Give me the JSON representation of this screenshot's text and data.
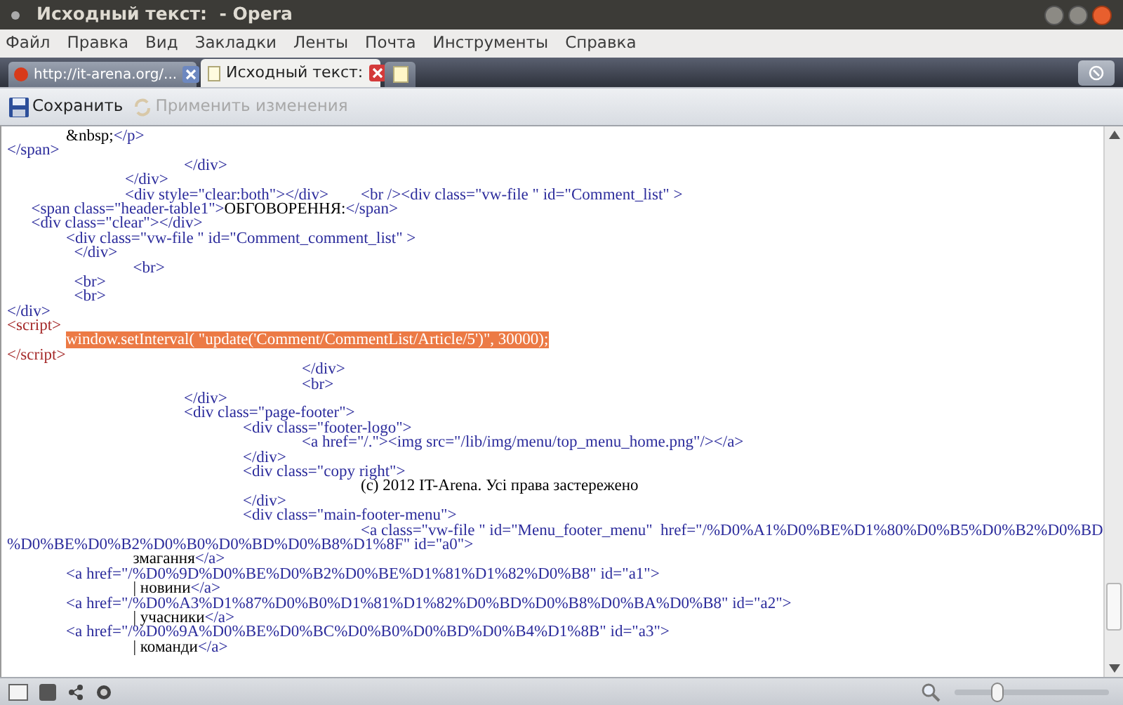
{
  "window": {
    "title": "Исходный текст:  - Opera"
  },
  "menu": [
    {
      "label": "Файл"
    },
    {
      "label": "Правка"
    },
    {
      "label": "Вид"
    },
    {
      "label": "Закладки"
    },
    {
      "label": "Ленты"
    },
    {
      "label": "Почта"
    },
    {
      "label": "Инструменты"
    },
    {
      "label": "Справка"
    }
  ],
  "tabs": [
    {
      "title": "http://it-arena.org/...",
      "selected": false
    },
    {
      "title": "Исходный текст:",
      "selected": true
    }
  ],
  "toolbar": [
    {
      "label": "Сохранить",
      "disabled": false
    },
    {
      "label": "Применить изменения",
      "disabled": true
    }
  ],
  "source_lines": [
    {
      "parts": [
        {
          "kind": "text",
          "text": "\t&nbsp;"
        },
        {
          "kind": "tag",
          "text": "</p>"
        }
      ]
    },
    {
      "parts": [
        {
          "kind": "tag",
          "text": "</span>"
        }
      ]
    },
    {
      "parts": [
        {
          "kind": "tag",
          "text": "\t\t\t</div>"
        }
      ]
    },
    {
      "parts": [
        {
          "kind": "tag",
          "text": "\t\t</div>"
        }
      ]
    },
    {
      "parts": [
        {
          "kind": "tag",
          "text": "\t\t<div style=\"clear:both\"></div>        <br /><div class=\"vw-file \" id=\"Comment_list\" >"
        }
      ]
    },
    {
      "parts": [
        {
          "kind": "tag",
          "text": "      <span class=\"header-table1\">"
        },
        {
          "kind": "text",
          "text": "ОБГОВОРЕННЯ:"
        },
        {
          "kind": "tag",
          "text": "</span>"
        }
      ]
    },
    {
      "parts": [
        {
          "kind": "tag",
          "text": "      <div class=\"clear\"></div>"
        }
      ]
    },
    {
      "parts": [
        {
          "kind": "tag",
          "text": "\t<div class=\"vw-file \" id=\"Comment_comment_list\" >"
        }
      ]
    },
    {
      "parts": [
        {
          "kind": "tag",
          "text": "\t  </div>"
        }
      ]
    },
    {
      "parts": [
        {
          "kind": "tag",
          "text": "\t\t  <br>"
        }
      ]
    },
    {
      "parts": [
        {
          "kind": "tag",
          "text": "\t  <br>"
        }
      ]
    },
    {
      "parts": [
        {
          "kind": "tag",
          "text": "\t  <br>"
        }
      ]
    },
    {
      "parts": [
        {
          "kind": "tag",
          "text": "</div>"
        }
      ]
    },
    {
      "parts": [
        {
          "kind": "script",
          "text": "<script>"
        }
      ]
    },
    {
      "parts": [
        {
          "kind": "selected",
          "text": "\twindow.setInterval( \"update('Comment/CommentList/Article/5')\", 30000);"
        }
      ]
    },
    {
      "parts": [
        {
          "kind": "script",
          "text": "</script>"
        }
      ]
    },
    {
      "parts": [
        {
          "kind": "tag",
          "text": "\t\t\t\t\t</div>"
        }
      ]
    },
    {
      "parts": [
        {
          "kind": "tag",
          "text": "\t\t\t\t\t<br>"
        }
      ]
    },
    {
      "parts": [
        {
          "kind": "tag",
          "text": "\t\t\t</div>"
        }
      ]
    },
    {
      "parts": [
        {
          "kind": "tag",
          "text": "\t\t\t<div class=\"page-footer\">"
        }
      ]
    },
    {
      "parts": [
        {
          "kind": "tag",
          "text": "\t\t\t\t<div class=\"footer-logo\">"
        }
      ]
    },
    {
      "parts": [
        {
          "kind": "tag",
          "text": "\t\t\t\t\t<a href=\"/.\"><img src=\"/lib/img/menu/top_menu_home.png\"/></a>"
        }
      ]
    },
    {
      "parts": [
        {
          "kind": "tag",
          "text": "\t\t\t\t</div>"
        }
      ]
    },
    {
      "parts": [
        {
          "kind": "tag",
          "text": "\t\t\t\t<div class=\"copy right\">"
        }
      ]
    },
    {
      "parts": [
        {
          "kind": "text",
          "text": "\t\t\t\t\t\t(c) 2012 IT-Arena. Усі права застережено"
        }
      ]
    },
    {
      "parts": [
        {
          "kind": "tag",
          "text": "\t\t\t\t</div>"
        }
      ]
    },
    {
      "parts": [
        {
          "kind": "tag",
          "text": "\t\t\t\t<div class=\"main-footer-menu\">"
        }
      ]
    },
    {
      "parts": [
        {
          "kind": "tag",
          "text": "\t\t\t\t\t\t<a class=\"vw-file \" id=\"Menu_footer_menu\"  href=\"/%D0%A1%D0%BE%D1%80%D0%B5%D0%B2%D0%BD"
        }
      ]
    },
    {
      "parts": [
        {
          "kind": "tag",
          "text": "%D0%BE%D0%B2%D0%B0%D0%BD%D0%B8%D1%8F\" id=\"a0\">"
        }
      ]
    },
    {
      "parts": [
        {
          "kind": "text",
          "text": "\t\t  змагання"
        },
        {
          "kind": "tag",
          "text": "</a>"
        }
      ]
    },
    {
      "parts": [
        {
          "kind": "tag",
          "text": "\t<a href=\"/%D0%9D%D0%BE%D0%B2%D0%BE%D1%81%D1%82%D0%B8\" id=\"a1\">"
        }
      ]
    },
    {
      "parts": [
        {
          "kind": "text",
          "text": "\t\t  | новини"
        },
        {
          "kind": "tag",
          "text": "</a>"
        }
      ]
    },
    {
      "parts": [
        {
          "kind": "tag",
          "text": "\t<a href=\"/%D0%A3%D1%87%D0%B0%D1%81%D1%82%D0%BD%D0%B8%D0%BA%D0%B8\" id=\"a2\">"
        }
      ]
    },
    {
      "parts": [
        {
          "kind": "text",
          "text": "\t\t  | учасники"
        },
        {
          "kind": "tag",
          "text": "</a>"
        }
      ]
    },
    {
      "parts": [
        {
          "kind": "tag",
          "text": "\t<a href=\"/%D0%9A%D0%BE%D0%BC%D0%B0%D0%BD%D0%B4%D1%8B\" id=\"a3\">"
        }
      ]
    },
    {
      "parts": [
        {
          "kind": "text",
          "text": "\t\t  | команди"
        },
        {
          "kind": "tag",
          "text": "</a>"
        }
      ]
    }
  ],
  "status_bar": {
    "zoom": {
      "level": 0.28
    }
  }
}
